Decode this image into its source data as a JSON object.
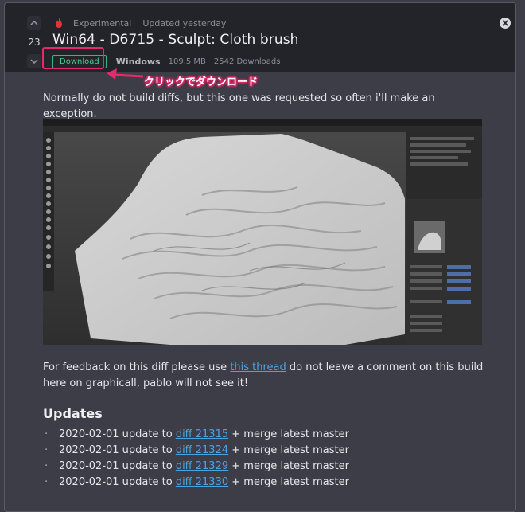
{
  "vote": {
    "count": "23"
  },
  "header": {
    "label": "Experimental",
    "updated": "Updated yesterday",
    "title": "Win64 - D6715 - Sculpt: Cloth brush",
    "download_label": "Download",
    "platform": "Windows",
    "size": "109.5 MB",
    "downloads": "2542 Downloads"
  },
  "annotation": {
    "text": "クリックでダウンロード",
    "color": "#e8286a"
  },
  "content": {
    "intro": "Normally do not build diffs, but this one was requested so often i'll make an exception.",
    "feedback_before": "For feedback on this diff please use ",
    "feedback_link": "this thread",
    "feedback_after": " do not leave a comment on this build here on graphicall, pablo will not see it!",
    "updates_heading": "Updates",
    "updates": [
      {
        "date": "2020-02-01 update to ",
        "link": "diff 21315",
        "rest": " + merge latest master"
      },
      {
        "date": "2020-02-01 update to ",
        "link": "diff 21324",
        "rest": " + merge latest master"
      },
      {
        "date": "2020-02-01 update to ",
        "link": "diff 21329",
        "rest": " + merge latest master"
      },
      {
        "date": "2020-02-01 update to ",
        "link": "diff 21330",
        "rest": " + merge latest master"
      }
    ]
  },
  "colors": {
    "accent_green": "#3ab67d",
    "link": "#4ba3e3",
    "background": "#3d3d48",
    "header": "#23232a"
  }
}
